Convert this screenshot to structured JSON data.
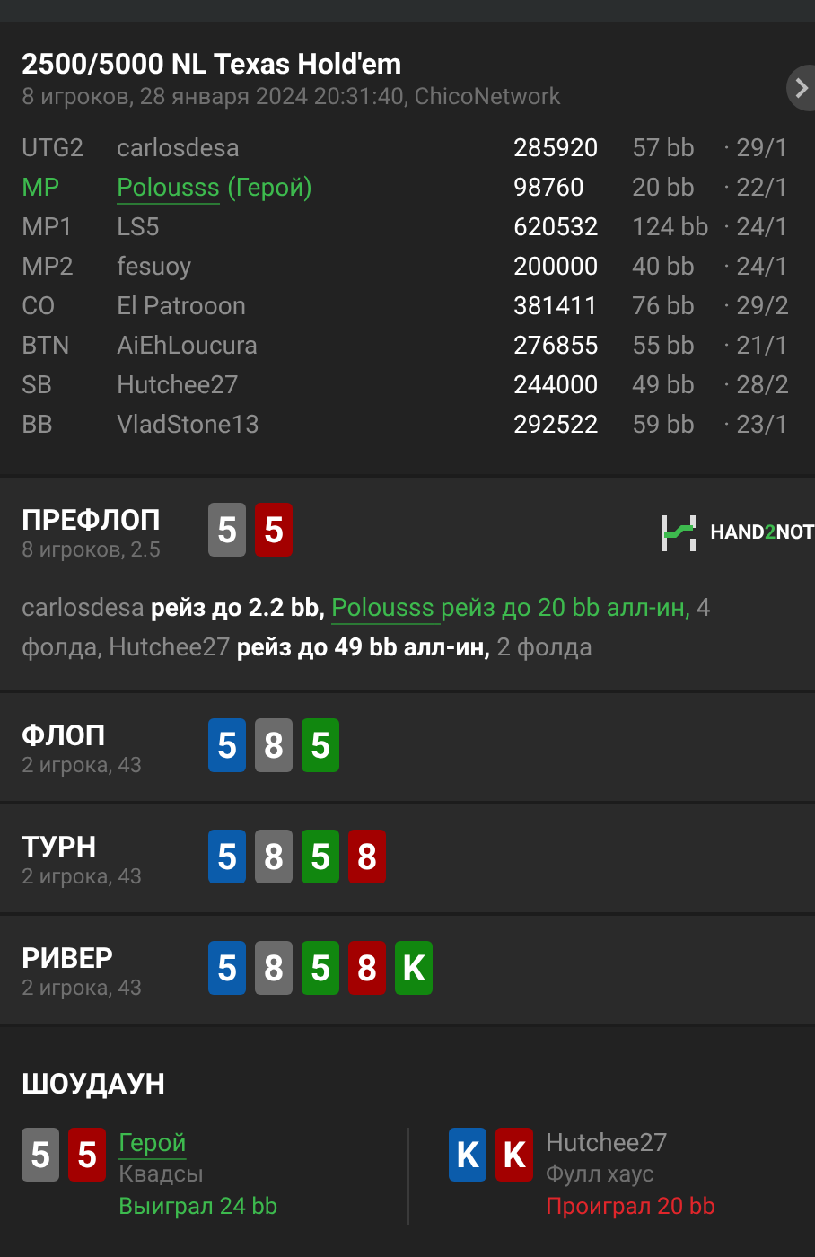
{
  "header": {
    "title": "2500/5000 NL Texas Hold'em",
    "subtitle": "8 игроков, 28 января 2024 20:31:40, ChicoNetwork"
  },
  "players": [
    {
      "position": "UTG2",
      "name": "carlosdesa",
      "hero": false,
      "stack": "285920",
      "bb": "57 bb",
      "stats": "· 29/1"
    },
    {
      "position": "MP",
      "name": "Polousss",
      "hero": true,
      "hero_tag": "(Герой)",
      "stack": "98760",
      "bb": "20 bb",
      "stats": "· 22/1"
    },
    {
      "position": "MP1",
      "name": "LS5",
      "hero": false,
      "stack": "620532",
      "bb": "124 bb",
      "stats": "· 24/1"
    },
    {
      "position": "MP2",
      "name": "fesuoy",
      "hero": false,
      "stack": "200000",
      "bb": "40 bb",
      "stats": "· 24/1"
    },
    {
      "position": "CO",
      "name": "El Patrooon",
      "hero": false,
      "stack": "381411",
      "bb": "76 bb",
      "stats": "· 29/2"
    },
    {
      "position": "BTN",
      "name": "AiEhLoucura",
      "hero": false,
      "stack": "276855",
      "bb": "55 bb",
      "stats": "· 21/1"
    },
    {
      "position": "SB",
      "name": "Hutchee27",
      "hero": false,
      "stack": "244000",
      "bb": "49 bb",
      "stats": "· 28/2"
    },
    {
      "position": "BB",
      "name": "VladStone13",
      "hero": false,
      "stack": "292522",
      "bb": "59 bb",
      "stats": "· 23/1"
    }
  ],
  "streets": [
    {
      "title": "ПРЕФЛОП",
      "info": "8 игроков, 2.5",
      "cards": [
        {
          "rank": "5",
          "color": "#6b6b6b"
        },
        {
          "rank": "5",
          "color": "#a30000"
        }
      ],
      "logo": [
        "HAND",
        "2",
        "NOT"
      ],
      "actions": [
        {
          "kind": "name",
          "text": "carlosdesa"
        },
        {
          "kind": "action",
          "text": "рейз до 2.2 bb,"
        },
        {
          "kind": "hero",
          "text": "Polousss"
        },
        {
          "kind": "hero_action",
          "text": "рейз до 20 bb алл-ин,"
        },
        {
          "kind": "plain",
          "text": "4 фолда,"
        },
        {
          "kind": "name",
          "text": "Hutchee27"
        },
        {
          "kind": "action",
          "text": "рейз до 49 bb алл-ин,"
        },
        {
          "kind": "plain",
          "text": "2 фолда"
        }
      ]
    },
    {
      "title": "ФЛОП",
      "info": "2 игрока, 43",
      "cards": [
        {
          "rank": "5",
          "color": "#0b5cab"
        },
        {
          "rank": "8",
          "color": "#6b6b6b"
        },
        {
          "rank": "5",
          "color": "#11870f"
        }
      ]
    },
    {
      "title": "ТУРН",
      "info": "2 игрока, 43",
      "cards": [
        {
          "rank": "5",
          "color": "#0b5cab"
        },
        {
          "rank": "8",
          "color": "#6b6b6b"
        },
        {
          "rank": "5",
          "color": "#11870f"
        },
        {
          "rank": "8",
          "color": "#a30000"
        }
      ]
    },
    {
      "title": "РИВЕР",
      "info": "2 игрока, 43",
      "cards": [
        {
          "rank": "5",
          "color": "#0b5cab"
        },
        {
          "rank": "8",
          "color": "#6b6b6b"
        },
        {
          "rank": "5",
          "color": "#11870f"
        },
        {
          "rank": "8",
          "color": "#a30000"
        },
        {
          "rank": "K",
          "color": "#11870f"
        }
      ]
    }
  ],
  "showdown": {
    "title": "ШОУДАУН",
    "hands": [
      {
        "name": "Герой",
        "hero": true,
        "combo": "Квадсы",
        "won": true,
        "result": "Выиграл 24 bb",
        "cards": [
          {
            "rank": "5",
            "color": "#6b6b6b"
          },
          {
            "rank": "5",
            "color": "#a30000"
          }
        ]
      },
      {
        "name": "Hutchee27",
        "hero": false,
        "combo": "Фулл хаус",
        "won": false,
        "result": "Проиграл 20 bb",
        "cards": [
          {
            "rank": "K",
            "color": "#0b5cab"
          },
          {
            "rank": "K",
            "color": "#a30000"
          }
        ]
      }
    ]
  }
}
